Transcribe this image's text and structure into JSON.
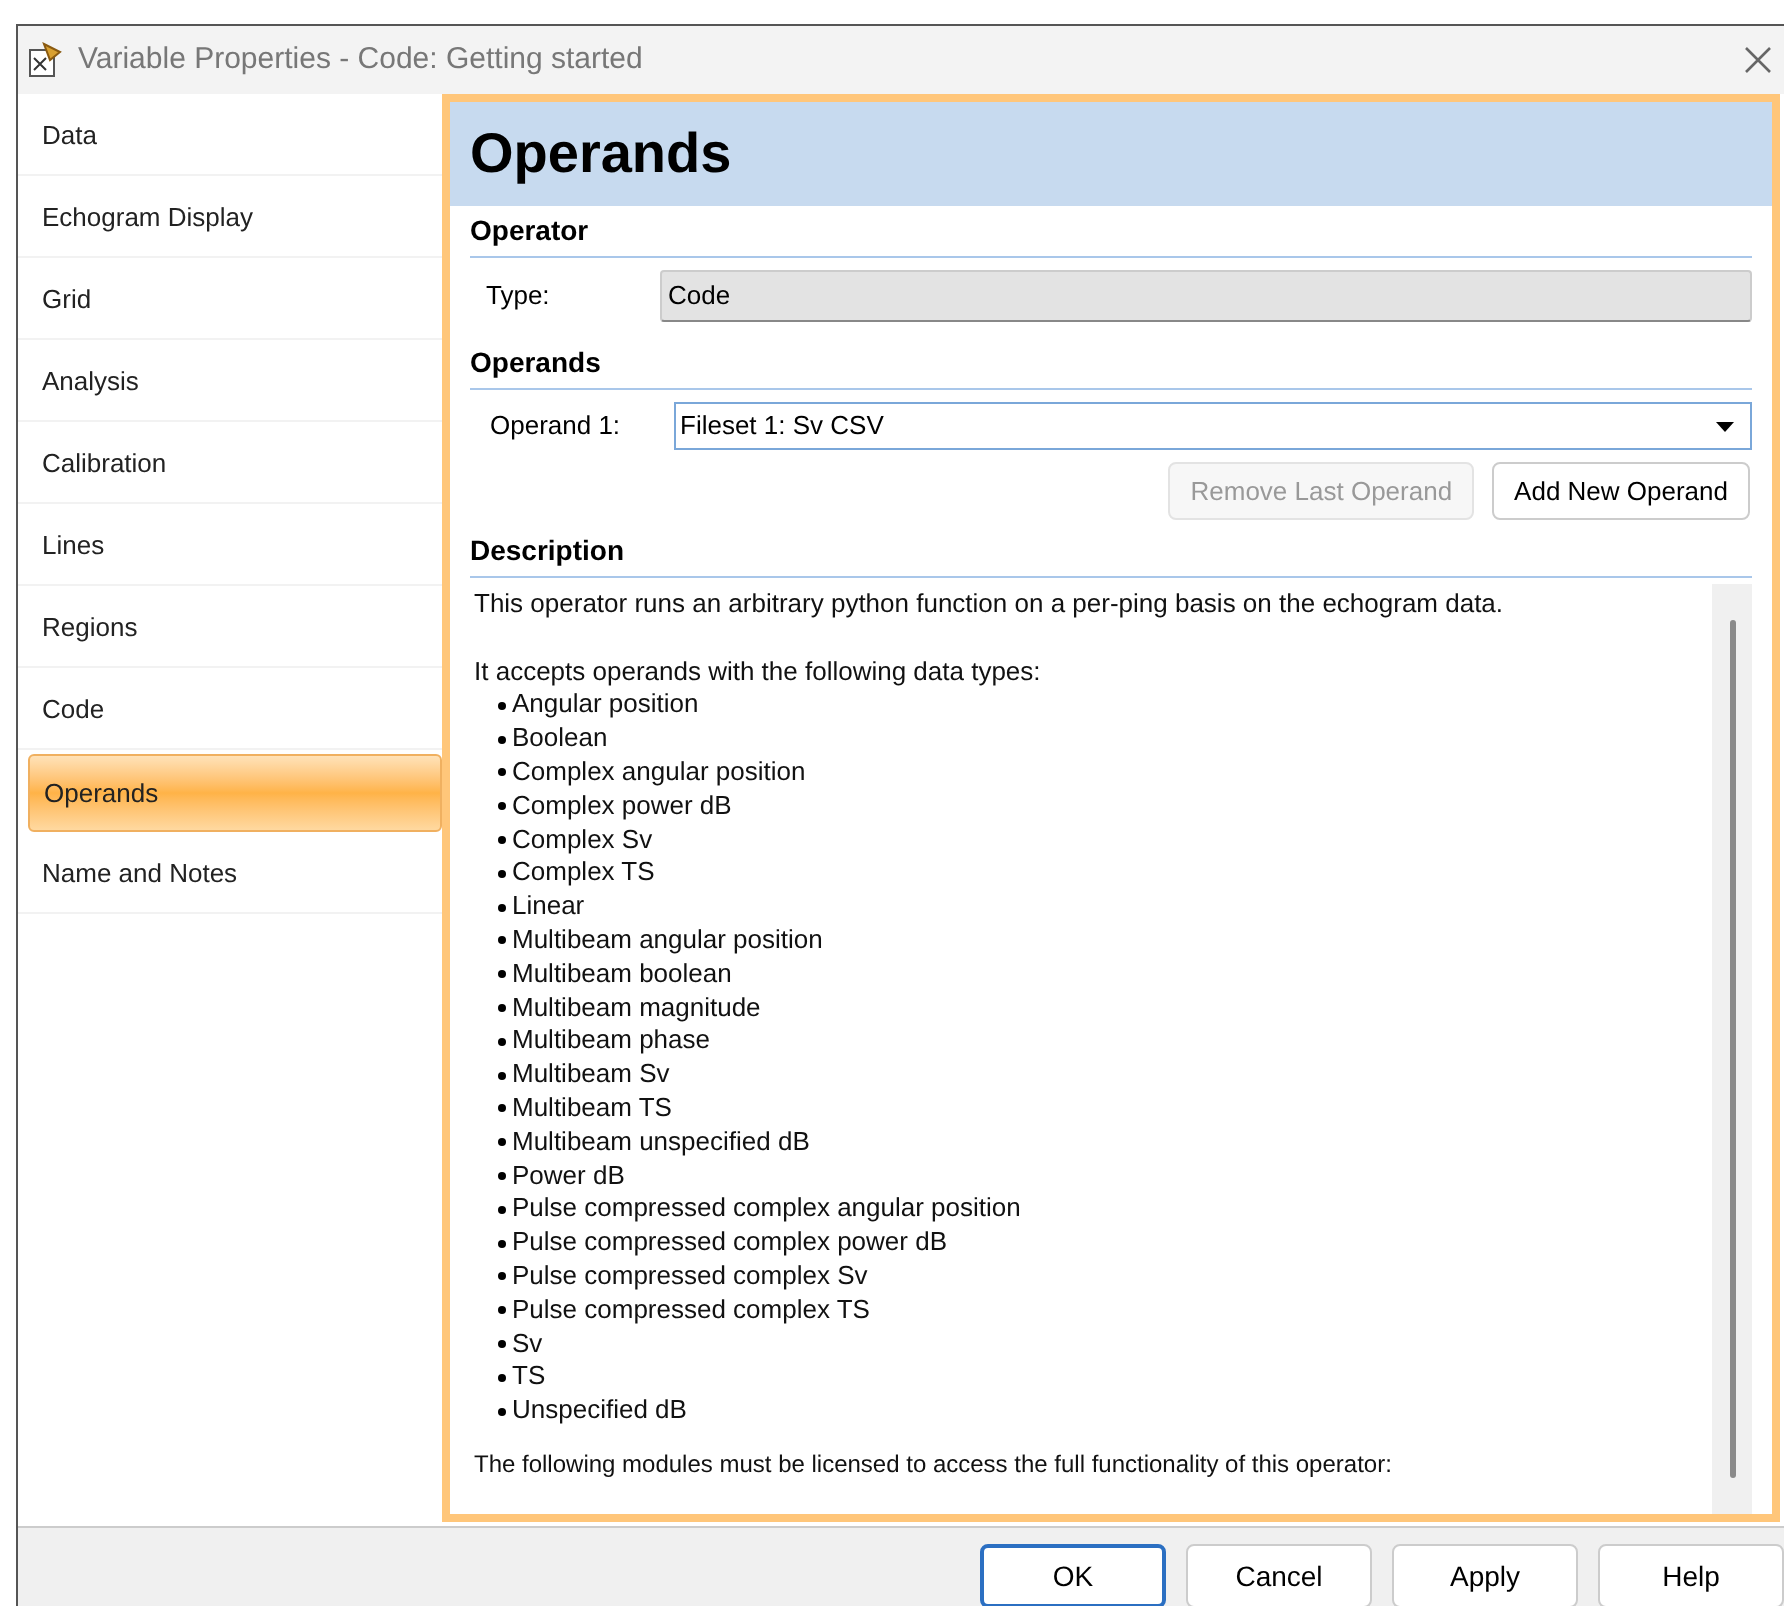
{
  "window": {
    "title": "Variable Properties - Code: Getting started"
  },
  "sidebar": {
    "items": [
      {
        "label": "Data",
        "selected": false
      },
      {
        "label": "Echogram Display",
        "selected": false
      },
      {
        "label": "Grid",
        "selected": false
      },
      {
        "label": "Analysis",
        "selected": false
      },
      {
        "label": "Calibration",
        "selected": false
      },
      {
        "label": "Lines",
        "selected": false
      },
      {
        "label": "Regions",
        "selected": false
      },
      {
        "label": "Code",
        "selected": false
      },
      {
        "label": "Operands",
        "selected": true
      },
      {
        "label": "Name and Notes",
        "selected": false
      }
    ]
  },
  "page": {
    "heading": "Operands",
    "operator": {
      "heading": "Operator",
      "type_label": "Type:",
      "type_value": "Code"
    },
    "operands": {
      "heading": "Operands",
      "rows": [
        {
          "label": "Operand 1:",
          "value": "Fileset 1: Sv CSV"
        }
      ],
      "buttons": [
        {
          "label": "Remove Last Operand",
          "disabled": true
        },
        {
          "label": "Add New Operand",
          "disabled": false
        }
      ]
    },
    "description": {
      "heading": "Description",
      "intro": "This operator runs an arbitrary python function on a per-ping basis on the echogram data.",
      "list_heading": "It accepts operands with the following data types:",
      "types": [
        "Angular position",
        "Boolean",
        "Complex angular position",
        "Complex power dB",
        "Complex Sv",
        "Complex TS",
        "Linear",
        "Multibeam angular position",
        "Multibeam boolean",
        "Multibeam magnitude",
        "Multibeam phase",
        "Multibeam Sv",
        "Multibeam TS",
        "Multibeam unspecified dB",
        "Power dB",
        "Pulse compressed complex angular position",
        "Pulse compressed complex power dB",
        "Pulse compressed complex Sv",
        "Pulse compressed complex TS",
        "Sv",
        "TS",
        "Unspecified dB"
      ],
      "footer": "The following modules must be licensed to access the full functionality of this operator:"
    }
  },
  "buttons": [
    {
      "label": "OK",
      "default": true
    },
    {
      "label": "Cancel",
      "default": false
    },
    {
      "label": "Apply",
      "default": false
    },
    {
      "label": "Help",
      "default": false
    }
  ]
}
